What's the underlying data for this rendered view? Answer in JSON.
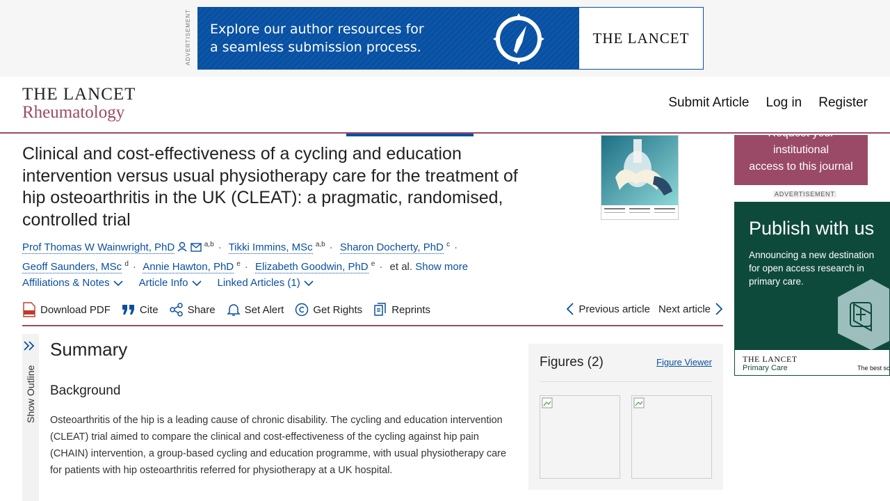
{
  "top_ad": {
    "label": "ADVERTISEMENT",
    "line1": "Explore our author resources for",
    "line2": "a seamless submission process.",
    "brand": "THE LANCET"
  },
  "header": {
    "logo_line1": "THE LANCET",
    "logo_line2": "Rheumatology",
    "nav": {
      "submit": "Submit Article",
      "login": "Log in",
      "register": "Register"
    }
  },
  "article": {
    "title": "Clinical and cost-effectiveness of a cycling and education intervention versus usual physiotherapy care for the treatment of hip osteoarthritis in the UK (CLEAT): a pragmatic, randomised, controlled trial",
    "authors": [
      {
        "name": "Prof Thomas W Wainwright, PhD",
        "sup": "a,b"
      },
      {
        "name": "Tikki Immins, MSc",
        "sup": "a,b"
      },
      {
        "name": "Sharon Docherty, PhD",
        "sup": "c"
      },
      {
        "name": "Geoff Saunders, MSc",
        "sup": "d"
      },
      {
        "name": "Annie Hawton, PhD",
        "sup": "e"
      },
      {
        "name": "Elizabeth Goodwin, PhD",
        "sup": "e"
      }
    ],
    "et_al": "et al.",
    "show_more": "Show more",
    "info_tabs": {
      "affiliations": "Affiliations & Notes",
      "article_info": "Article Info",
      "linked": "Linked Articles (1)"
    },
    "toolbar": {
      "download_pdf": "Download PDF",
      "cite": "Cite",
      "share": "Share",
      "set_alert": "Set Alert",
      "get_rights": "Get Rights",
      "reprints": "Reprints"
    },
    "previous": "Previous article",
    "next": "Next article"
  },
  "outline": {
    "label": "Show Outline"
  },
  "summary": {
    "heading": "Summary",
    "background_heading": "Background",
    "background_text": "Osteoarthritis of the hip is a leading cause of chronic disability. The cycling and education intervention (CLEAT) trial aimed to compare the clinical and cost-effectiveness of the cycling against hip pain (CHAIN) intervention, a group-based cycling and education programme, with usual physiotherapy care for patients with hip osteoarthritis referred for physiotherapy at a UK hospital."
  },
  "figures": {
    "heading": "Figures (2)",
    "viewer": "Figure Viewer"
  },
  "side": {
    "institution": [
      "Request your",
      "institutional",
      "access to this journal"
    ],
    "ad_label": "ADVERTISEMENT",
    "ad_heading": "Publish with us",
    "ad_text": "Announcing a new destination for open access research in primary care.",
    "ad_brand1": "THE LANCET",
    "ad_brand2": "Primary Care",
    "ad_tagline": "The best science"
  },
  "colors": {
    "brand_purple": "#9a4a66",
    "link_blue": "#0a4f9e",
    "ad_green": "#0e4a3c"
  }
}
